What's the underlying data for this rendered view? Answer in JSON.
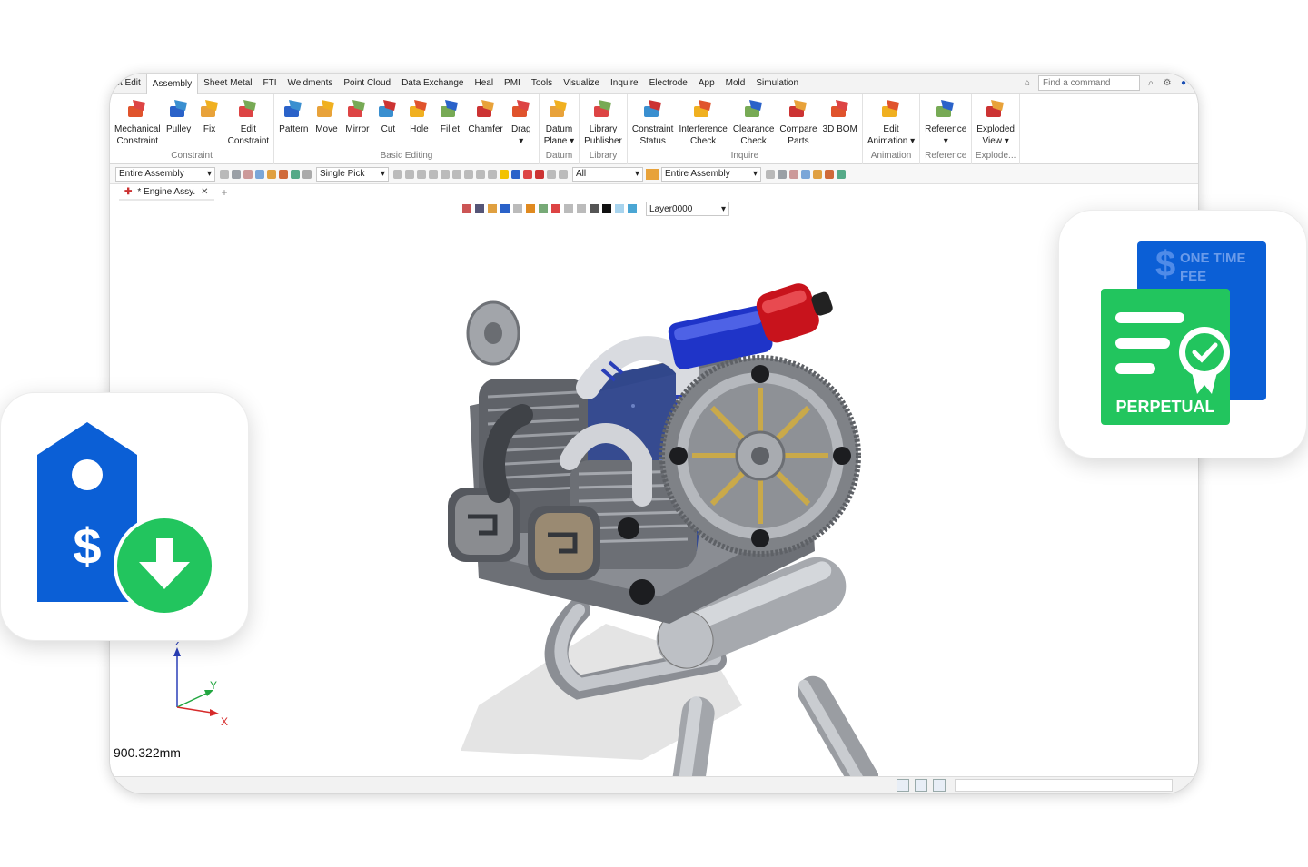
{
  "menu": {
    "tabs": [
      "ct Edit",
      "Assembly",
      "Sheet Metal",
      "FTI",
      "Weldments",
      "Point Cloud",
      "Data Exchange",
      "Heal",
      "PMI",
      "Tools",
      "Visualize",
      "Inquire",
      "Electrode",
      "App",
      "Mold",
      "Simulation"
    ],
    "active_tab": "Assembly",
    "search_placeholder": "Find a command"
  },
  "ribbon": {
    "groups": [
      {
        "label": "Constraint",
        "buttons": [
          "Mechanical\nConstraint",
          "Pulley",
          "Fix",
          "Edit\nConstraint"
        ]
      },
      {
        "label": "Basic Editing",
        "buttons": [
          "Pattern",
          "Move",
          "Mirror",
          "Cut",
          "Hole",
          "Fillet",
          "Chamfer",
          "Drag\n▾"
        ]
      },
      {
        "label": "Datum",
        "buttons": [
          "Datum\nPlane ▾"
        ]
      },
      {
        "label": "Library",
        "buttons": [
          "Library\nPublisher"
        ]
      },
      {
        "label": "Inquire",
        "buttons": [
          "Constraint\nStatus",
          "Interference\nCheck",
          "Clearance\nCheck",
          "Compare\nParts",
          "3D BOM"
        ]
      },
      {
        "label": "Animation",
        "buttons": [
          "Edit\nAnimation ▾"
        ]
      },
      {
        "label": "Reference",
        "buttons": [
          "Reference\n▾"
        ]
      },
      {
        "label": "Explode...",
        "buttons": [
          "Exploded\nView ▾"
        ]
      }
    ]
  },
  "toolbar": {
    "scope_left": "Entire Assembly",
    "pick_mode": "Single Pick",
    "filter": "All",
    "scope_right": "Entire Assembly",
    "layer": "Layer0000"
  },
  "document_tab": "* Engine Assy.",
  "viewport": {
    "scale_readout": "900.322mm",
    "axis_labels": {
      "z": "Z",
      "y": "Y",
      "x": "X"
    }
  },
  "cards": {
    "license_top_line1": "ONE TIME",
    "license_top_line2": "FEE",
    "license_badge": "PERPETUAL",
    "price_tag_symbol": "$",
    "license_dollar_symbol": "$"
  },
  "colors": {
    "green": "#22c55e",
    "blue": "#0b5fd6",
    "accent": "#1a73e8"
  }
}
